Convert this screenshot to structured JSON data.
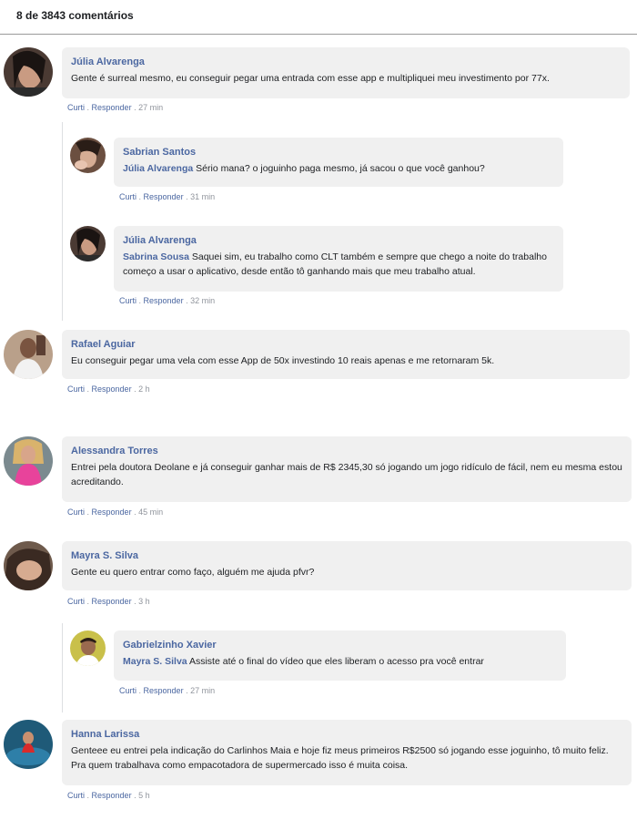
{
  "header": {
    "title": "8 de 3843 comentários"
  },
  "actions": {
    "like": "Curti",
    "sep": " . ",
    "reply": "Responder"
  },
  "comments": [
    {
      "author": "Júlia Alvarenga",
      "text": "Gente é surreal mesmo, eu conseguir pegar uma entrada com esse app e multipliquei meu investimento por 77x.",
      "time": " . 27 min"
    },
    {
      "author": "Sabrian Santos",
      "mention": "Júlia Alvarenga",
      "text": "Sério mana? o joguinho paga mesmo, já sacou o que você ganhou?",
      "time": " . 31 min"
    },
    {
      "author": "Júlia Alvarenga",
      "mention": "Sabrina Sousa",
      "text": "Saquei sim, eu trabalho como CLT também e sempre que chego a noite do trabalho começo a usar o aplicativo, desde então tô ganhando mais que meu trabalho atual.",
      "time": " . 32 min"
    },
    {
      "author": "Rafael Aguiar",
      "text": "Eu conseguir pegar uma vela com esse App de 50x investindo 10 reais apenas e me retornaram 5k.",
      "time": " . 2 h"
    },
    {
      "author": "Alessandra Torres",
      "text": "Entrei pela doutora Deolane e já conseguir ganhar mais de R$ 2345,30 só jogando um jogo ridículo de fácil, nem eu mesma estou acreditando.",
      "time": " . 45 min"
    },
    {
      "author": "Mayra S. Silva",
      "text": "Gente eu quero entrar como faço, alguém me ajuda pfvr?",
      "time": " . 3 h"
    },
    {
      "author": "Gabrielzinho Xavier",
      "mention": "Mayra S. Silva",
      "text": "Assiste até o final do vídeo que eles liberam o acesso pra você entrar",
      "time": " . 27 min"
    },
    {
      "author": "Hanna Larissa",
      "text": "Genteee eu entrei pela indicação do Carlinhos Maia e hoje fiz meus primeiros R$2500 só jogando esse joguinho, tô muito feliz. Pra quem trabalhava como empacotadora de supermercado isso é muita coisa.",
      "time": " . 5 h"
    }
  ]
}
